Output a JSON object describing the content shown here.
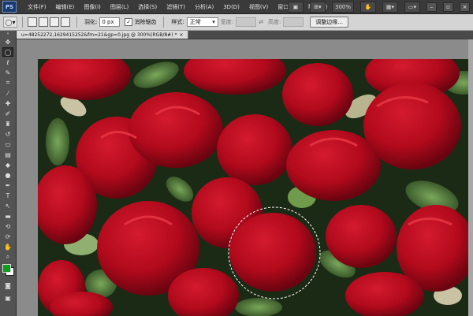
{
  "app": {
    "logo": "PS"
  },
  "menus": [
    "文件(F)",
    "编辑(E)",
    "图像(I)",
    "图层(L)",
    "选择(S)",
    "滤镜(T)",
    "分析(A)",
    "3D(D)",
    "视图(V)",
    "窗口(W)",
    "帮助(H)"
  ],
  "menubar_right": {
    "zoom": "300%",
    "min": "–",
    "restore": "▫",
    "close": "×"
  },
  "options": {
    "feather_label": "羽化:",
    "feather_value": "0 px",
    "antialias_label": "消除锯齿",
    "antialias_checked": true,
    "style_label": "样式:",
    "style_value": "正常",
    "width_label": "宽度:",
    "height_label": "高度:",
    "refine_edge_button": "调整边缘..."
  },
  "document": {
    "tab_title": "u=48252272,1629415252&fm=21&gp=0.jpg @ 300%(RGB/8#) *",
    "close": "×"
  },
  "colors": {
    "foreground": "#0b9e1c",
    "background": "#ffffff"
  },
  "tools": [
    "move-icon",
    "elliptical-marquee-icon",
    "lasso-icon",
    "quick-select-icon",
    "crop-icon",
    "eyedropper-icon",
    "healing-brush-icon",
    "brush-icon",
    "clone-stamp-icon",
    "history-brush-icon",
    "eraser-icon",
    "gradient-icon",
    "blur-icon",
    "dodge-icon",
    "pen-icon",
    "type-icon",
    "path-select-icon",
    "shape-icon",
    "3d-rotate-icon",
    "3d-camera-icon",
    "hand-icon",
    "zoom-icon"
  ]
}
